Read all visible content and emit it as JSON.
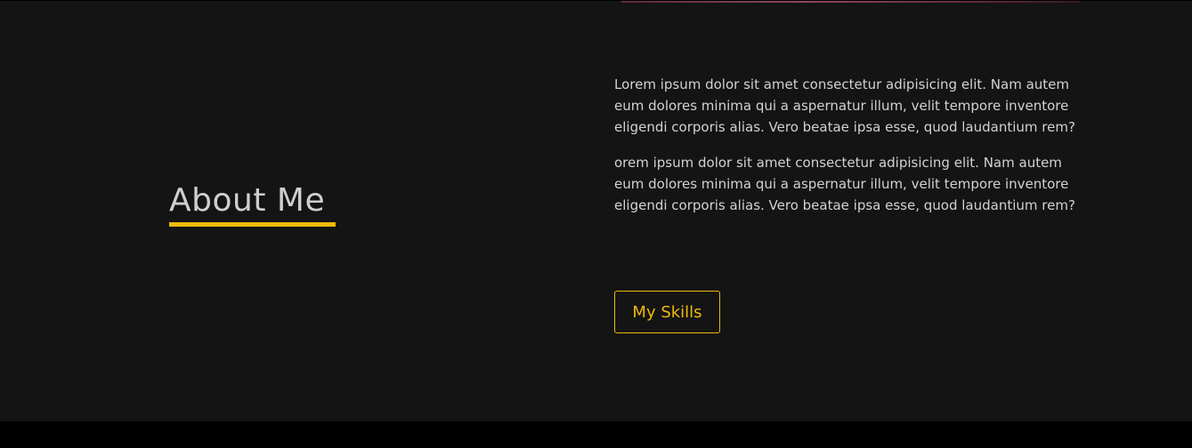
{
  "about": {
    "title": "About Me",
    "paragraphs": [
      "Lorem ipsum dolor sit amet consectetur adipisicing elit. Nam autem eum dolores minima qui a aspernatur illum, velit tempore inventore eligendi corporis alias. Vero beatae ipsa esse, quod laudantium rem?",
      "orem ipsum dolor sit amet consectetur adipisicing elit. Nam autem eum dolores minima qui a aspernatur illum, velit tempore inventore eligendi corporis alias. Vero beatae ipsa esse, quod laudantium rem?"
    ],
    "button_label": "My Skills"
  },
  "colors": {
    "background": "#141414",
    "footer_band": "#000000",
    "accent": "#f0b90b",
    "text": "#d2d2d2",
    "heading": "#cfcfcf"
  }
}
